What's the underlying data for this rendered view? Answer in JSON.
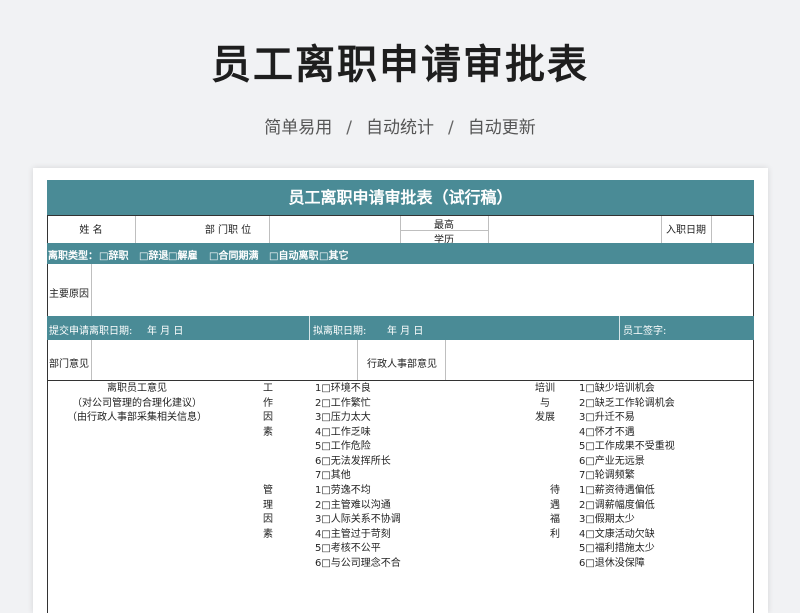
{
  "hero": {
    "title": "员工离职申请审批表",
    "subtitle_parts": [
      "简单易用",
      "自动统计",
      "自动更新"
    ],
    "separator": "/"
  },
  "form": {
    "title": "员工离职申请审批表（试行稿）",
    "row1": {
      "name_label": "姓  名",
      "dept_label": "部 门职 位",
      "edu_top": "最高",
      "edu_bottom": "学历",
      "join_label": "入职日期"
    },
    "leave_type": {
      "label": "离职类型：",
      "options": [
        "□辞职",
        "□辞退",
        "□解雇",
        "□合同期满",
        "□自动离职",
        "□其它"
      ]
    },
    "main_reason_label": "主要原因",
    "dates_row": {
      "submit_label": "提交申请离职日期:",
      "submit_date": "年    月    日",
      "plan_label": "拟离职日期:",
      "plan_date": "年    月    日",
      "sign_label": "员工签字:"
    },
    "opinions": {
      "dept_label": "部门意见",
      "admin_label": "行政人事部意见"
    },
    "employee_opinion": {
      "lines": [
        "离职员工意见",
        "（对公司管理的合理化建议）",
        "（由行政人事部采集相关信息）"
      ]
    },
    "work_factors": {
      "header": [
        "工",
        "作",
        "因",
        "素"
      ],
      "items": [
        "1□环境不良",
        "2□工作繁忙",
        "3□压力太大",
        "4□工作乏味",
        "5□工作危险",
        "6□无法发挥所长",
        "7□其他"
      ]
    },
    "management": {
      "header": [
        "管",
        "理",
        "因",
        "素"
      ],
      "items": [
        "1□劳逸不均",
        "2□主管难以沟通",
        "3□人际关系不协调",
        "4□主管过于苛刻",
        "5□考核不公平",
        "6□与公司理念不合"
      ]
    },
    "training": {
      "header": [
        "培训",
        "与",
        "发展"
      ],
      "items": [
        "1□缺少培训机会",
        "2□缺乏工作轮调机会",
        "3□升迁不易",
        "4□怀才不遇",
        "5□工作成果不受重视",
        "6□产业无远景",
        "7□轮调频繁"
      ]
    },
    "welfare": {
      "header": [
        "待",
        "遇",
        "福",
        "利"
      ],
      "items": [
        "1□薪资待遇偏低",
        "2□调薪幅度偏低",
        "3□假期太少",
        "4□文康活动欠缺",
        "5□福利措施太少",
        "6□退休没保障"
      ]
    }
  },
  "colors": {
    "teal": "#4a8b96",
    "background": "#f1f2f4"
  }
}
